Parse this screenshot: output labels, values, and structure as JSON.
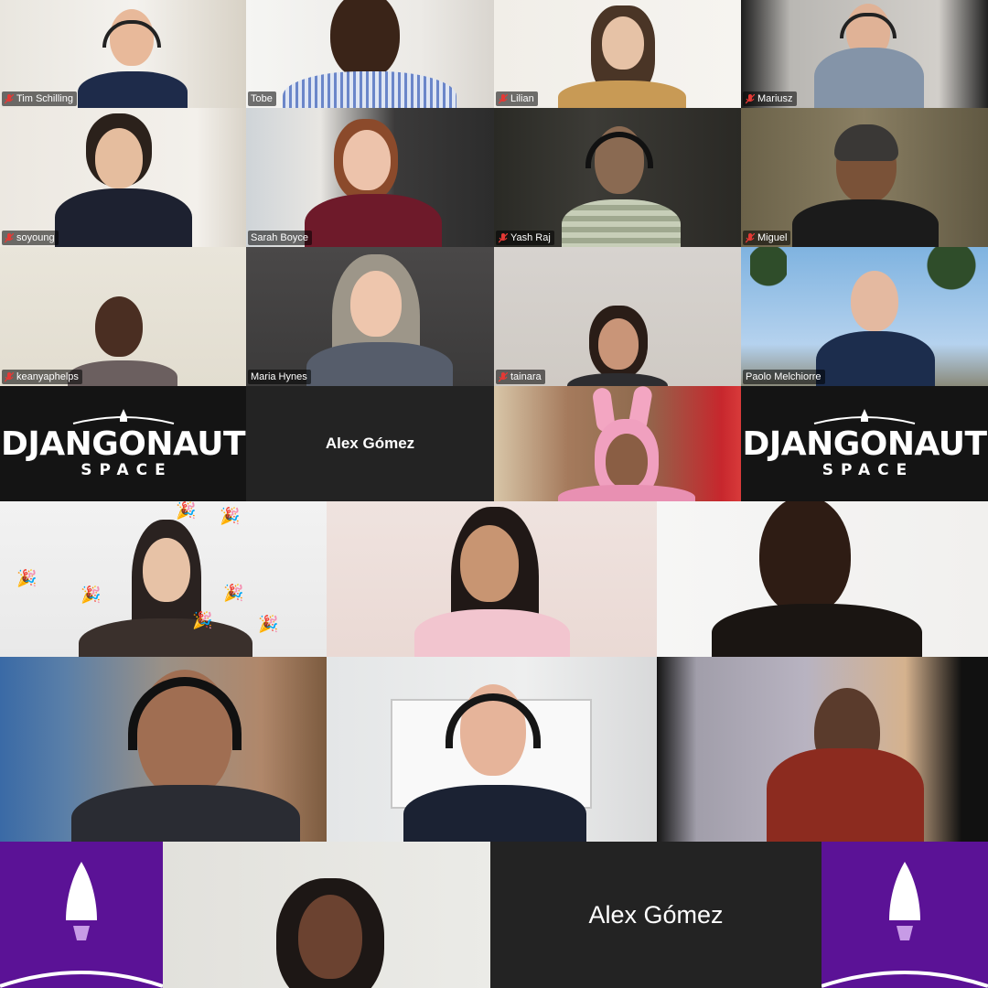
{
  "row1": [
    {
      "name": "Tim Schilling",
      "muted": true
    },
    {
      "name": "Tobe",
      "muted": false
    },
    {
      "name": "Lilian",
      "muted": true
    },
    {
      "name": "Mariusz",
      "muted": true
    }
  ],
  "row2": [
    {
      "name": "soyoung",
      "muted": true
    },
    {
      "name": "Sarah Boyce",
      "muted": false
    },
    {
      "name": "Yash Raj",
      "muted": true
    },
    {
      "name": "Miguel",
      "muted": true
    }
  ],
  "row3": [
    {
      "name": "keanyaphelps",
      "muted": true
    },
    {
      "name": "Maria Hynes",
      "muted": false
    },
    {
      "name": "tainara",
      "muted": true
    },
    {
      "name": "Paolo Melchiorre",
      "muted": false
    }
  ],
  "brand": {
    "word": "DJANGONAUT",
    "sub": "SPACE"
  },
  "row4_name_only": "Alex Gómez",
  "row7_name_only": "Alex Gómez",
  "colors": {
    "active_border": "#22c55e",
    "brand_purple": "#5b1296",
    "tile_dark": "#232323",
    "muted_red": "#e53935"
  }
}
